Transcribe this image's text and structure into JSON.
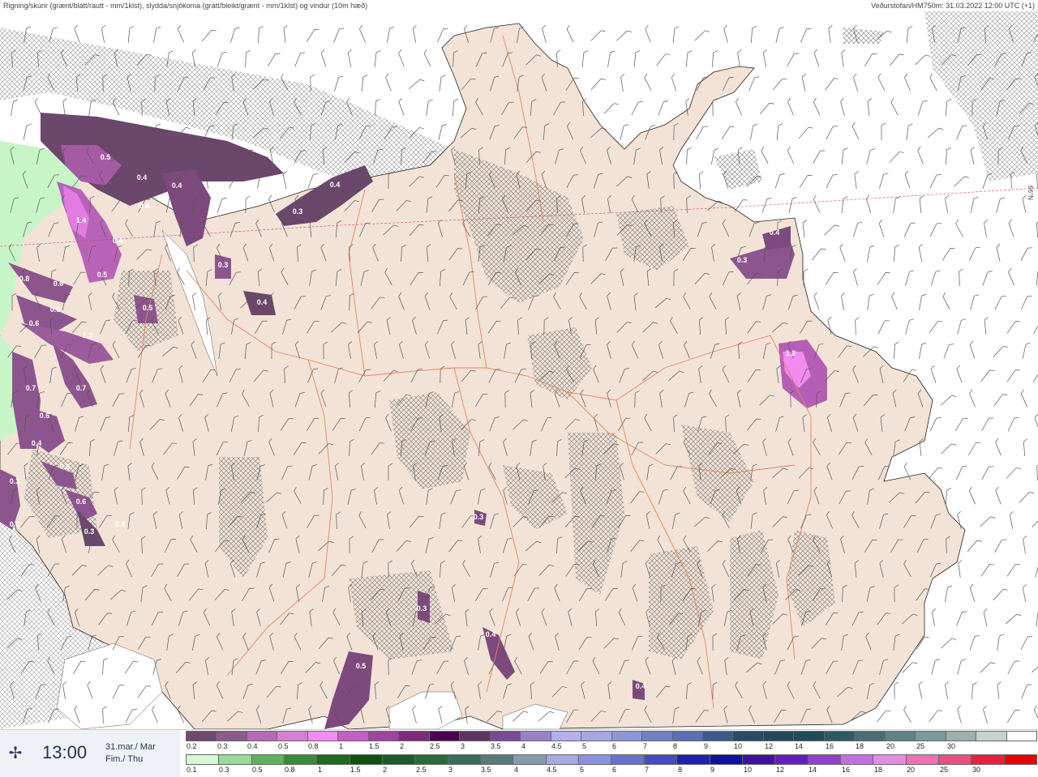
{
  "header": {
    "left": "Rigning/skúrir (grænt/blátt/rautt - mm/1klst), slydda/snjókoma (grátt/bleikt/grænt - mm/1klst) og vindur (10m hæð)",
    "right": "Veðurstofan/HM750m: 31.03.2022 12:00 UTC (+1)"
  },
  "time": {
    "icon": "wind-icon",
    "value": "13:00",
    "date_line1": "31.mar./ Mar",
    "date_line2": "Fim./ Thu"
  },
  "map": {
    "lat_label": "66°N",
    "precip_labels": [
      {
        "text": "0.5"
      },
      {
        "text": "0.4"
      },
      {
        "text": "0.4"
      },
      {
        "text": "0.4"
      },
      {
        "text": "0.4"
      },
      {
        "text": "0.5"
      },
      {
        "text": "0.8"
      },
      {
        "text": "0.6"
      },
      {
        "text": "0.6"
      },
      {
        "text": "0.6"
      },
      {
        "text": "1.3"
      },
      {
        "text": "0.7"
      },
      {
        "text": "0.7"
      },
      {
        "text": "0.6"
      },
      {
        "text": "0.4"
      },
      {
        "text": "0.6"
      },
      {
        "text": "0.6"
      },
      {
        "text": "0.3"
      },
      {
        "text": "0.4"
      },
      {
        "text": "0.3"
      },
      {
        "text": "0.4"
      },
      {
        "text": "0.3"
      },
      {
        "text": "0.3"
      },
      {
        "text": "0.4"
      },
      {
        "text": "0.5"
      },
      {
        "text": "0.3"
      },
      {
        "text": "0.4"
      },
      {
        "text": "0.5"
      },
      {
        "text": "1.2"
      },
      {
        "text": "0.4"
      },
      {
        "text": "0.3"
      },
      {
        "text": "0.3"
      },
      {
        "text": "0.3"
      },
      {
        "text": "0.4"
      },
      {
        "text": "1.4"
      }
    ]
  },
  "scales": {
    "snow": {
      "colors": [
        "#6e4a6e",
        "#8d5a8d",
        "#b56ab5",
        "#d57ed5",
        "#f48af4",
        "#c35fc3",
        "#a044a0",
        "#7d2a7d",
        "#4d0050",
        "#613461",
        "#7a4a9a",
        "#9a80c8",
        "#b5b0ea",
        "#a6a6e6",
        "#8e96d6",
        "#6f82c2",
        "#5a70b0",
        "#3c5a8a",
        "#2a4a6a",
        "#23485a",
        "#1e4e5a",
        "#2f5a64",
        "#4a6e74",
        "#5f8486",
        "#7b9a9a",
        "#9cb0b0",
        "#c7d2d2",
        "#ffffff"
      ],
      "ticks": [
        "0.2",
        "0.3",
        "0.4",
        "0.5",
        "0.8",
        "1",
        "1.5",
        "2",
        "2.5",
        "3",
        "3.5",
        "4",
        "4.5",
        "5",
        "6",
        "7",
        "8",
        "9",
        "10",
        "12",
        "14",
        "16",
        "18",
        "20",
        "25",
        "30"
      ]
    },
    "rain": {
      "colors": [
        "#d7f7d7",
        "#9bd89b",
        "#5fb05f",
        "#3a8a3a",
        "#1e6a1e",
        "#105010",
        "#1c5a2a",
        "#2a6a3a",
        "#3a6e5a",
        "#5a7a7a",
        "#8a9aaa",
        "#a6a8e0",
        "#8c90e0",
        "#6a70d0",
        "#4848c8",
        "#2020b0",
        "#1010a0",
        "#4010a0",
        "#6020c0",
        "#9040d0",
        "#c070e0",
        "#e090e0",
        "#f070b0",
        "#e85080",
        "#e82040",
        "#e80000"
      ],
      "ticks": [
        "0.1",
        "0.3",
        "0.5",
        "0.8",
        "1",
        "1.5",
        "2",
        "2.5",
        "3",
        "3.5",
        "4",
        "4.5",
        "5",
        "6",
        "7",
        "8",
        "9",
        "10",
        "12",
        "14",
        "16",
        "18",
        "20",
        "25",
        "30"
      ]
    }
  }
}
